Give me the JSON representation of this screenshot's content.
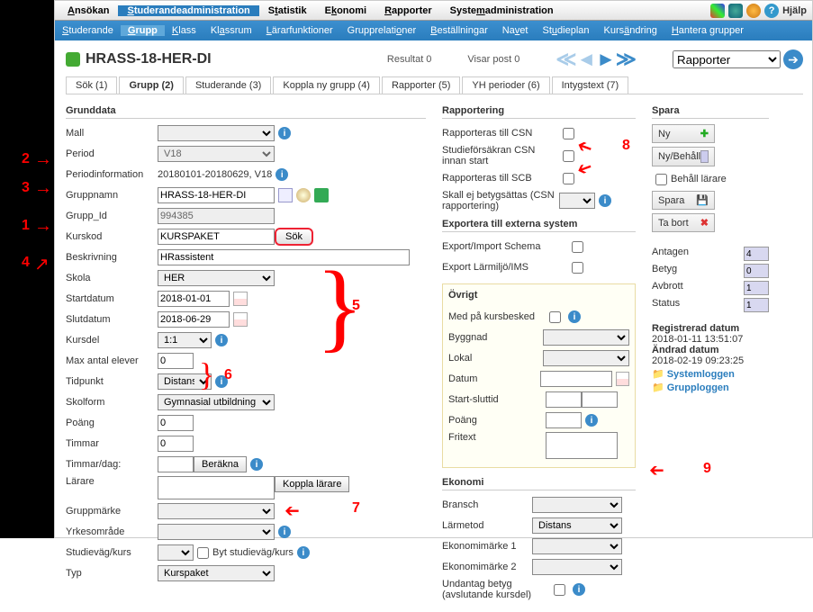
{
  "topnav": {
    "items": [
      "Ansökan",
      "Studerandeadministration",
      "Statistik",
      "Ekonomi",
      "Rapporter",
      "Systemadministration"
    ],
    "help": "Hjälp"
  },
  "subnav": {
    "items": [
      "Studerande",
      "Grupp",
      "Klass",
      "Klassrum",
      "Lärarfunktioner",
      "Grupprelationer",
      "Beställningar",
      "Navet",
      "Studieplan",
      "Kursändring",
      "Hantera grupper"
    ]
  },
  "header": {
    "title": "HRASS-18-HER-DI",
    "resultat": "Resultat 0",
    "visarpost": "Visar post 0",
    "rapporter_sel": "Rapporter"
  },
  "tabs": [
    "Sök (1)",
    "Grupp (2)",
    "Studerande (3)",
    "Koppla ny grupp (4)",
    "Rapporter (5)",
    "YH perioder (6)",
    "Intygstext (7)"
  ],
  "grunddata": {
    "title": "Grunddata",
    "mall": "Mall",
    "period": "Period",
    "period_val": "V18",
    "periodinfo": "Periodinformation",
    "periodinfo_val": "20180101-20180629, V18",
    "gruppnamn": "Gruppnamn",
    "gruppnamn_val": "HRASS-18-HER-DI",
    "gruppid": "Grupp_Id",
    "gruppid_val": "994385",
    "kurskod": "Kurskod",
    "kurskod_val": "KURSPAKET",
    "sok": "Sök",
    "beskrivning": "Beskrivning",
    "beskrivning_val": "HRassistent",
    "skola": "Skola",
    "skola_val": "HER",
    "startdatum": "Startdatum",
    "startdatum_val": "2018-01-01",
    "slutdatum": "Slutdatum",
    "slutdatum_val": "2018-06-29",
    "kursdel": "Kursdel",
    "kursdel_val": "1:1",
    "maxantal": "Max antal elever",
    "maxantal_val": "0",
    "tidpunkt": "Tidpunkt",
    "tidpunkt_val": "Distans",
    "skolform": "Skolform",
    "skolform_val": "Gymnasial utbildning",
    "poang": "Poäng",
    "poang_val": "0",
    "timmar": "Timmar",
    "timmar_val": "0",
    "timmardag": "Timmar/dag:",
    "berakna": "Beräkna",
    "larare": "Lärare",
    "koppla_larare": "Koppla lärare",
    "gruppmarke": "Gruppmärke",
    "yrkesomrade": "Yrkesområde",
    "studievag": "Studieväg/kurs",
    "byt_studievag": "Byt studieväg/kurs",
    "typ": "Typ",
    "typ_val": "Kurspaket"
  },
  "rapportering": {
    "title": "Rapportering",
    "csn": "Rapporteras till CSN",
    "studieforsakran": "Studieförsäkran CSN innan start",
    "scb": "Rapporteras till SCB",
    "skall_ej": "Skall ej betygsättas (CSN rapportering)"
  },
  "exportera": {
    "title": "Exportera till externa system",
    "schema": "Export/Import Schema",
    "larmiljo": "Export Lärmiljö/IMS"
  },
  "ovrigt": {
    "title": "Övrigt",
    "kursbesked": "Med på kursbesked",
    "byggnad": "Byggnad",
    "lokal": "Lokal",
    "datum": "Datum",
    "startsluttid": "Start-sluttid",
    "poang": "Poäng",
    "fritext": "Fritext"
  },
  "ekonomi": {
    "title": "Ekonomi",
    "bransch": "Bransch",
    "larmetod": "Lärmetod",
    "larmetod_val": "Distans",
    "em1": "Ekonomimärke 1",
    "em2": "Ekonomimärke 2",
    "undantag": "Undantag betyg (avslutande kursdel)"
  },
  "spara": {
    "title": "Spara",
    "ny": "Ny",
    "nybehall": "Ny/Behåll",
    "behall_larare": "Behåll lärare",
    "spara": "Spara",
    "tabort": "Ta bort"
  },
  "stats": {
    "antagen": "Antagen",
    "antagen_v": "4",
    "betyg": "Betyg",
    "betyg_v": "0",
    "avbrott": "Avbrott",
    "avbrott_v": "1",
    "status": "Status",
    "status_v": "1"
  },
  "reg": {
    "reg_label": "Registrerad datum",
    "reg_val": "2018-01-11 13:51:07",
    "andrad_label": "Ändrad datum",
    "andrad_val": "2018-02-19 09:23:25",
    "syslog": "Systemloggen",
    "grupplog": "Grupploggen"
  }
}
